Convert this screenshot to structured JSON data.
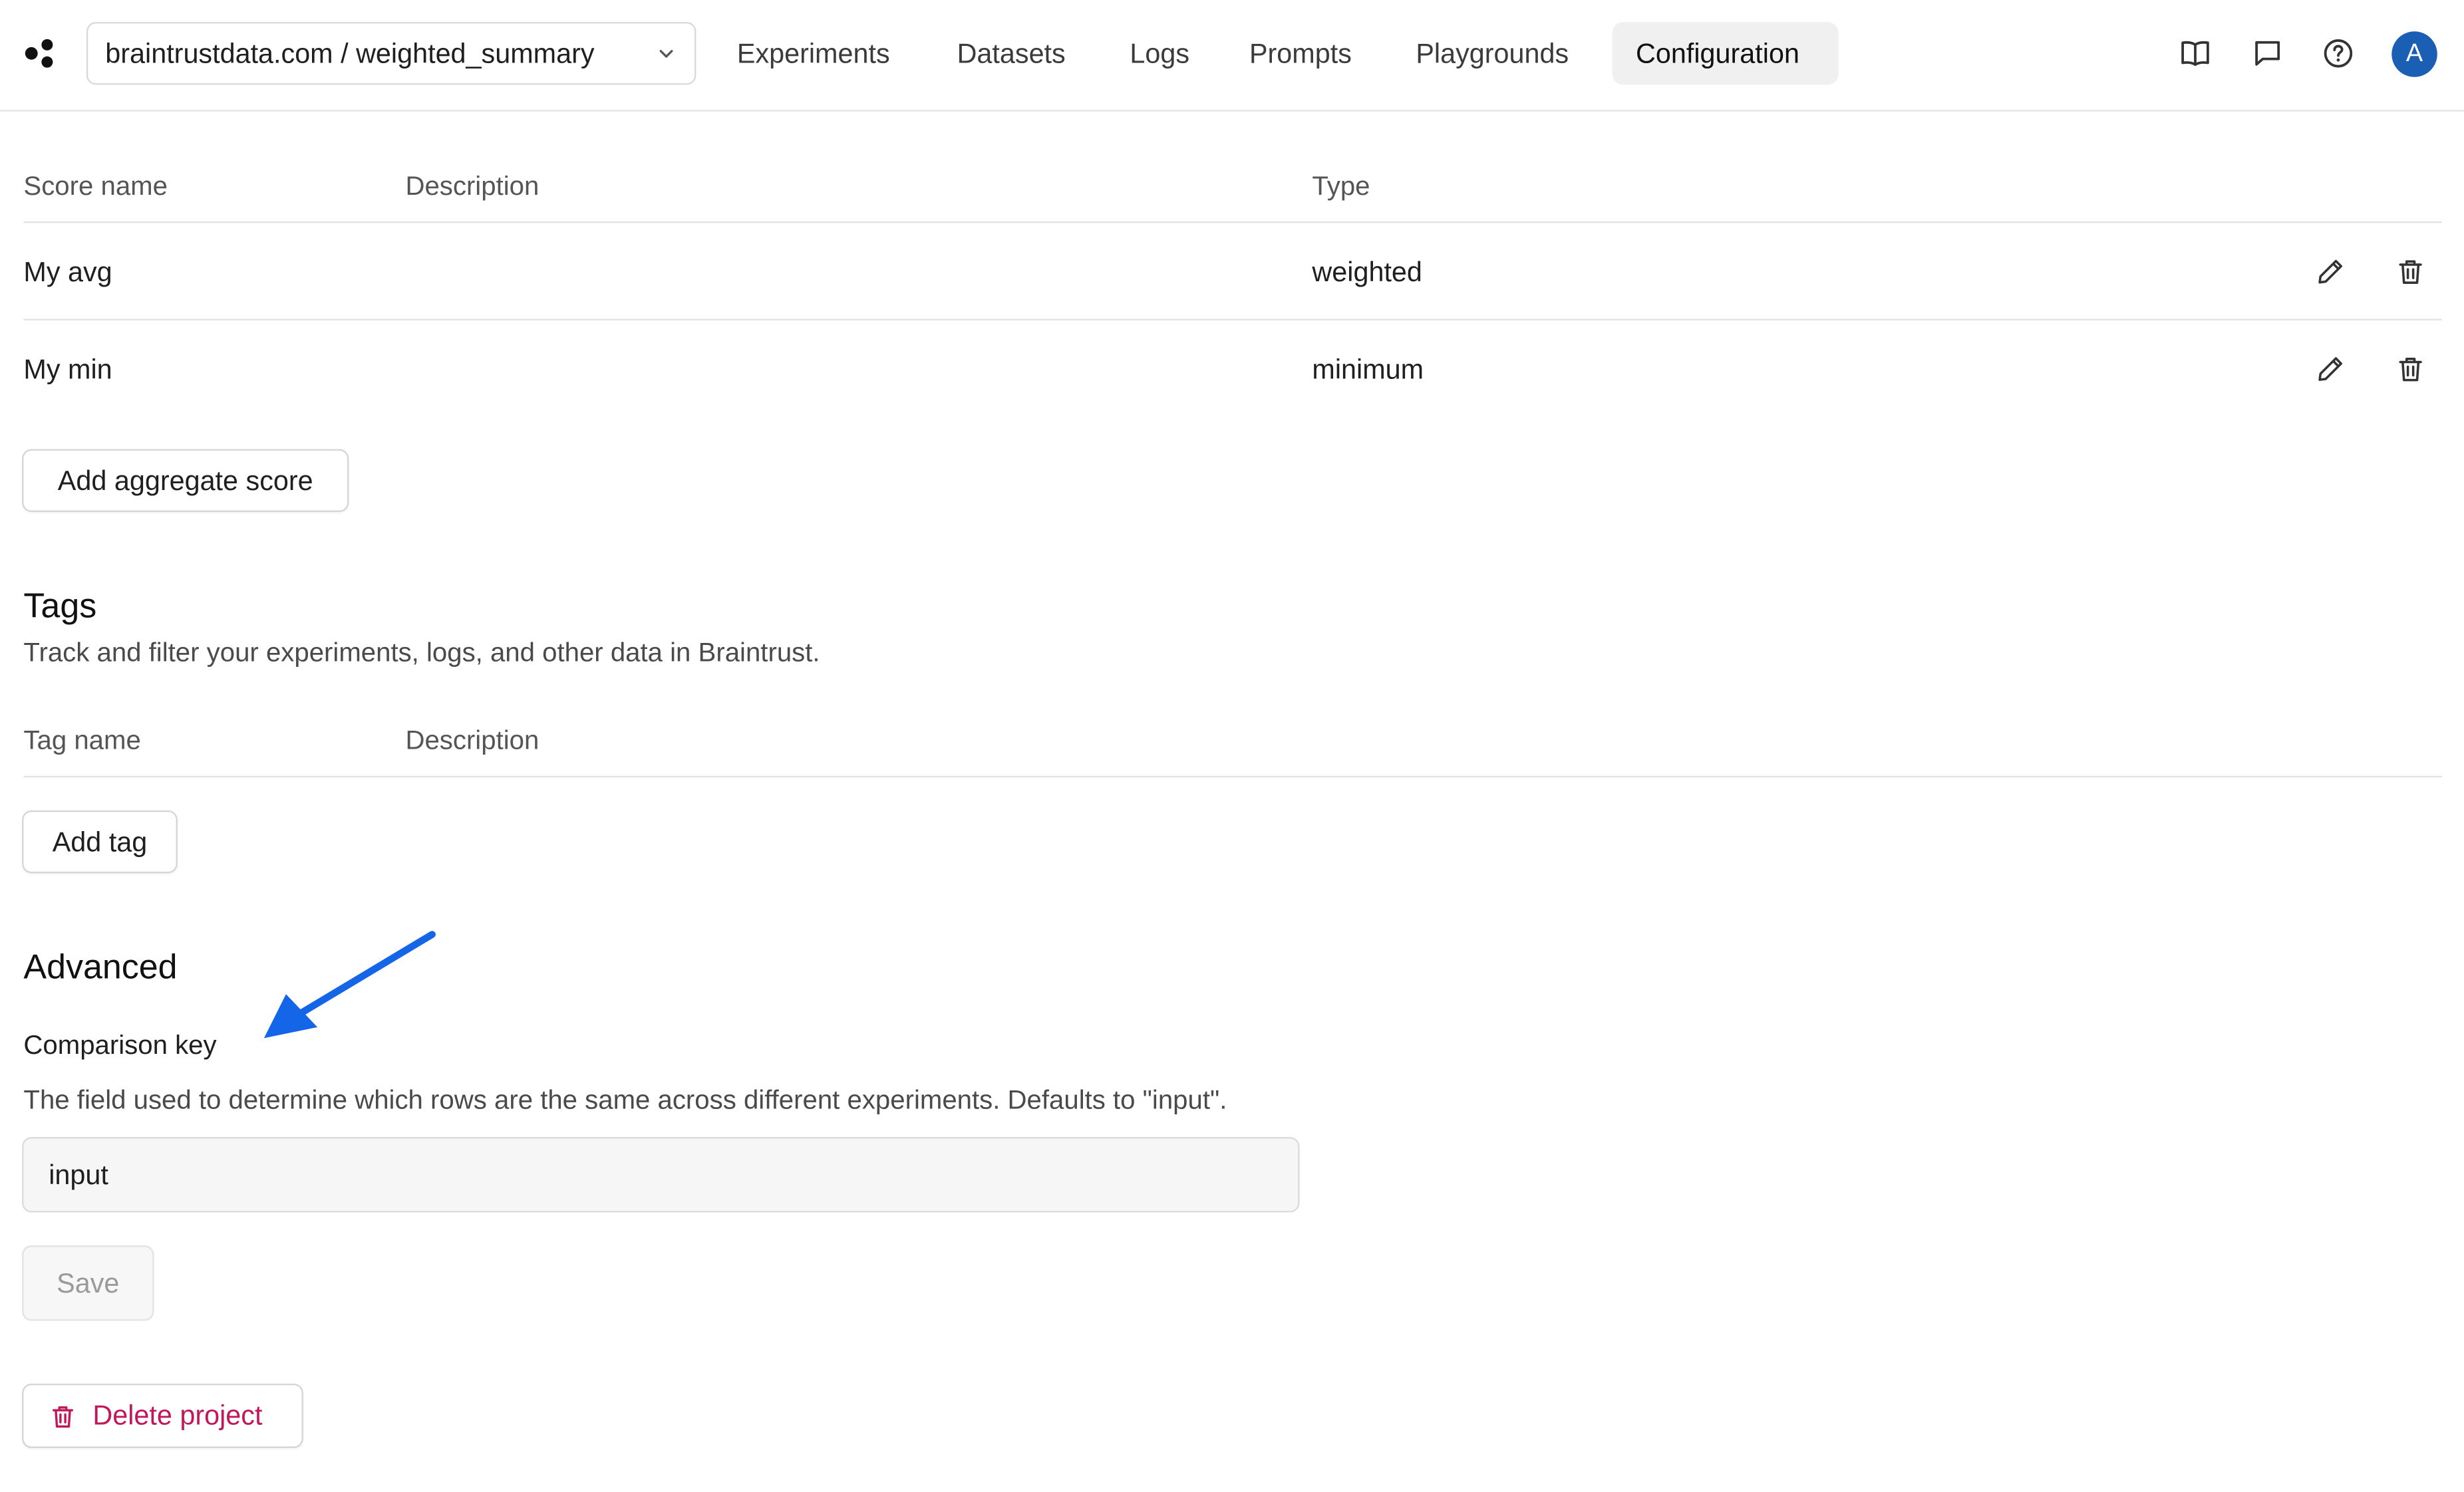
{
  "header": {
    "project_selector": "braintrustdata.com / weighted_summary",
    "nav": [
      "Experiments",
      "Datasets",
      "Logs",
      "Prompts",
      "Playgrounds",
      "Configuration"
    ],
    "active_nav": "Configuration",
    "avatar_initial": "A"
  },
  "scores": {
    "columns": [
      "Score name",
      "Description",
      "Type"
    ],
    "rows": [
      {
        "name": "My avg",
        "description": "",
        "type": "weighted"
      },
      {
        "name": "My min",
        "description": "",
        "type": "minimum"
      }
    ],
    "add_button": "Add aggregate score"
  },
  "tags": {
    "title": "Tags",
    "description": "Track and filter your experiments, logs, and other data in Braintrust.",
    "columns": [
      "Tag name",
      "Description"
    ],
    "add_button": "Add tag"
  },
  "advanced": {
    "title": "Advanced",
    "field_label": "Comparison key",
    "field_help": "The field used to determine which rows are the same across different experiments. Defaults to \"input\".",
    "field_value": "input",
    "save_button": "Save"
  },
  "danger": {
    "delete_button": "Delete project"
  },
  "colors": {
    "accent_arrow": "#1565e8",
    "avatar_bg": "#1a5fb4",
    "danger": "#c2185b"
  }
}
